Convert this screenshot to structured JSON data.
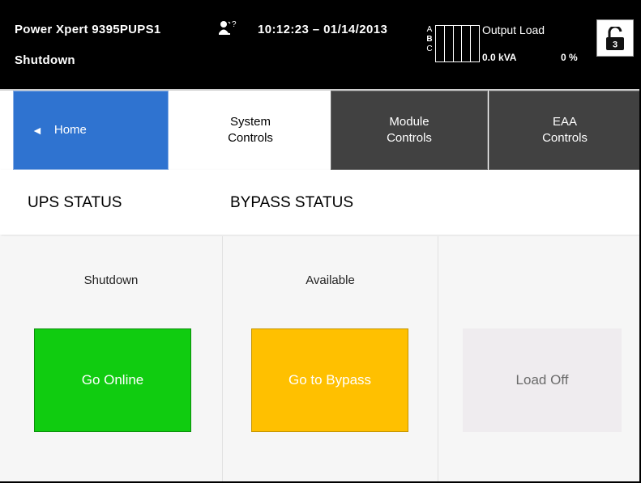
{
  "header": {
    "model": "Power Xpert 9395PUPS1",
    "state": "Shutdown",
    "user_icon_label": "?",
    "datetime": "10:12:23 – 01/14/2013",
    "phases": [
      "A",
      "B",
      "C"
    ],
    "output_load_label": "Output Load",
    "output_kva": "0.0 kVA",
    "output_percent": "0 %",
    "lock_level": "3"
  },
  "tabs": {
    "home": {
      "arrow": "◄",
      "label": "Home"
    },
    "system": {
      "line1": "System",
      "line2": "Controls"
    },
    "module": {
      "line1": "Module",
      "line2": "Controls"
    },
    "eaa": {
      "line1": "EAA",
      "line2": "Controls"
    }
  },
  "status": {
    "ups_title": "UPS STATUS",
    "bypass_title": "BYPASS STATUS"
  },
  "panels": {
    "ups": {
      "status": "Shutdown",
      "button": "Go Online"
    },
    "bypass": {
      "status": "Available",
      "button": "Go to Bypass"
    },
    "load": {
      "status": "",
      "button": "Load Off"
    }
  },
  "colors": {
    "home_tab": "#2f73d0",
    "inactive_tab": "#414141",
    "go_online": "#10cc10",
    "go_bypass": "#ffc000",
    "load_off_disabled": "#efecef"
  }
}
